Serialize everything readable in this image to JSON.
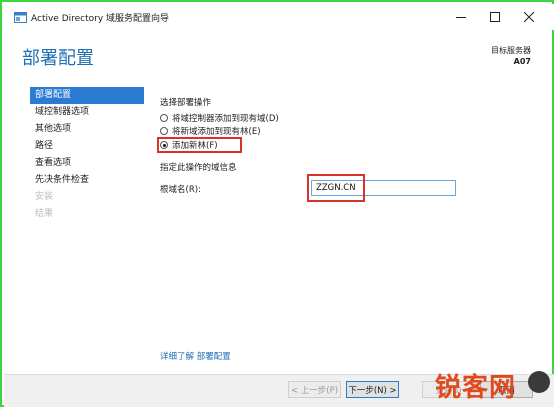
{
  "window": {
    "title": "Active Directory 域服务配置向导"
  },
  "header": {
    "page_title": "部署配置",
    "target_server_label": "目标服务器",
    "target_server_name": "A07"
  },
  "sidebar": {
    "items": [
      {
        "label": "部署配置",
        "state": "active"
      },
      {
        "label": "域控制器选项",
        "state": "normal"
      },
      {
        "label": "其他选项",
        "state": "normal"
      },
      {
        "label": "路径",
        "state": "normal"
      },
      {
        "label": "查看选项",
        "state": "normal"
      },
      {
        "label": "先决条件检查",
        "state": "normal"
      },
      {
        "label": "安装",
        "state": "disabled"
      },
      {
        "label": "结果",
        "state": "disabled"
      }
    ]
  },
  "main": {
    "operation_label": "选择部署操作",
    "options": [
      {
        "label": "将域控制器添加到现有域(D)",
        "checked": false
      },
      {
        "label": "将新域添加到现有林(E)",
        "checked": false
      },
      {
        "label": "添加新林(F)",
        "checked": true
      }
    ],
    "domain_info_label": "指定此操作的域信息",
    "root_domain_label": "根域名(R):",
    "root_domain_value": "ZZGN.CN",
    "more_info_link": "详细了解 部署配置"
  },
  "footer": {
    "prev_button": "< 上一步(P)",
    "next_button": "下一步(N) >",
    "install_button": "安装(I)",
    "cancel_button": "取消"
  },
  "watermark": {
    "text": "锐客网"
  },
  "colors": {
    "accent": "#2b7bd3",
    "title_blue": "#1f6fb5",
    "highlight_red": "#d9322b",
    "frame_green": "#3dd43d"
  }
}
